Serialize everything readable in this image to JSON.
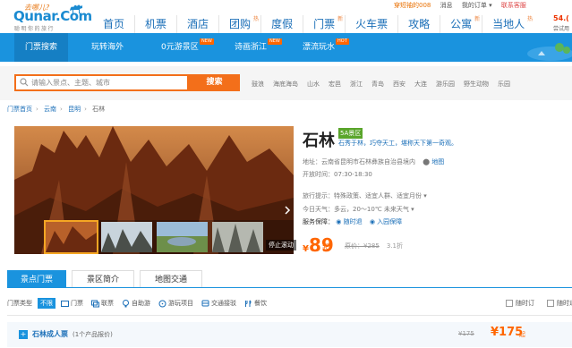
{
  "header": {
    "logo_sub": "去哪儿?",
    "logo": "Qunar.Com",
    "logo_tag": "聪明你的旅行",
    "user_links": {
      "name": "穿短袖的008",
      "msg": "消息",
      "orders": "我的订单 ▾",
      "service": "联系客服"
    },
    "nav": [
      {
        "label": "首页",
        "hot": ""
      },
      {
        "label": "机票",
        "hot": ""
      },
      {
        "label": "酒店",
        "hot": ""
      },
      {
        "label": "团购",
        "hot": "热"
      },
      {
        "label": "度假",
        "hot": ""
      },
      {
        "label": "门票",
        "hot": "新"
      },
      {
        "label": "火车票",
        "hot": ""
      },
      {
        "label": "攻略",
        "hot": ""
      },
      {
        "label": "公寓",
        "hot": "新"
      },
      {
        "label": "当地人",
        "hot": "热"
      }
    ],
    "corner_price": "54.(",
    "corner_sub": "尝试用"
  },
  "subnav": {
    "items": [
      {
        "label": "门票搜索",
        "new": ""
      },
      {
        "label": "玩转海外",
        "new": ""
      },
      {
        "label": "0元游景区",
        "new": "NEW"
      },
      {
        "label": "诗画浙江",
        "new": "NEW"
      },
      {
        "label": "漂流玩水",
        "new": "HOT"
      }
    ]
  },
  "search": {
    "placeholder": "请输入景点、主题、城市",
    "button": "搜索",
    "hotwords": [
      "鼓浪",
      "海底海岛",
      "山水",
      "宏邑",
      "浙江",
      "青岛",
      "西安",
      "大连",
      "游乐园",
      "野生动物",
      "乐园"
    ]
  },
  "breadcrumb": [
    "门票首页",
    "云南",
    "昆明",
    "石林"
  ],
  "gallery": {
    "stop_label": "停止滚动"
  },
  "detail": {
    "title": "石林",
    "level": "5A景区",
    "slogan": "石秀于林，巧夺天工，堪称天下第一奇观。",
    "address": "地址：云南省昆明市石林彝族自治县境内",
    "map": "地图",
    "hours": "开放时间：07:30-18:30",
    "tips": "旅行提示：特殊政策、适宜人群、适宜月份 ▾",
    "weather": "今日天气：多云，20～10℃        未来天气 ▾",
    "guarantee_label": "服务保障：",
    "guarantees": [
      "随时退",
      "入园保障"
    ],
    "price_currency": "¥",
    "price": "89",
    "price_suffix": "起",
    "orig_label": "原价：¥285",
    "discount": "3.1折"
  },
  "tabs": [
    "景点门票",
    "景区简介",
    "地图交通"
  ],
  "filter": {
    "label": "门票类型",
    "buxian": "不限",
    "options": [
      "门票",
      "联票",
      "自助游",
      "游玩项目",
      "交通接驳",
      "餐饮"
    ],
    "checks": [
      "随时订",
      "随时退"
    ]
  },
  "ticket": {
    "name": "石林成人票",
    "count": "(1个产品报价)",
    "orig": "¥175",
    "price": "¥175",
    "up": "起"
  },
  "colors": {
    "brand_blue": "#1a93de",
    "accent_orange": "#f36f1a",
    "price": "#ff6600"
  }
}
